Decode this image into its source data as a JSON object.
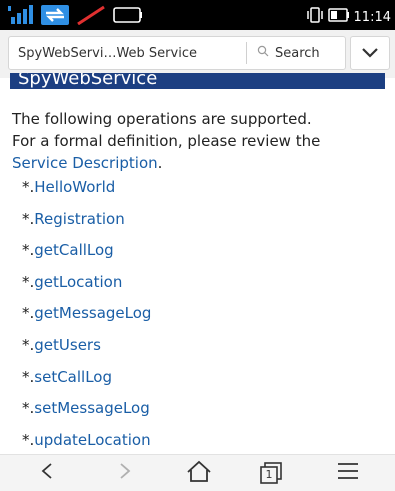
{
  "browser": {
    "url_title": "SpyWebServi…Web Service",
    "search_label": "Search"
  },
  "status_bar": {
    "time": "11:14"
  },
  "page": {
    "header": "SpyWebService",
    "intro_line1": "The following operations are supported.",
    "intro_line2": "For a formal definition, please review the",
    "service_description_link": "Service Description",
    "period": ".",
    "bullet": "*.",
    "operations": [
      "HelloWorld",
      "Registration",
      "getCallLog",
      "getLocation",
      "getMessageLog",
      "getUsers",
      "setCallLog",
      "setMessageLog",
      "updateLocation"
    ]
  },
  "icons": {
    "signal": "signal-icon",
    "sync": "sync-icon",
    "notification": "notification-icon",
    "vibrate": "vibrate-icon",
    "battery": "battery-icon",
    "search": "search-icon",
    "dropdown": "chevron-down-icon",
    "back": "back-icon",
    "forward": "forward-icon",
    "home": "home-icon",
    "tabs": "tabs-icon",
    "menu": "menu-icon"
  },
  "colors": {
    "header_bg": "#1c3f82",
    "link": "#1a5ea6",
    "status_bar_bg": "#000000",
    "signal": "#2f8fe4",
    "notification": "#e03030"
  },
  "tabs_count": "1"
}
